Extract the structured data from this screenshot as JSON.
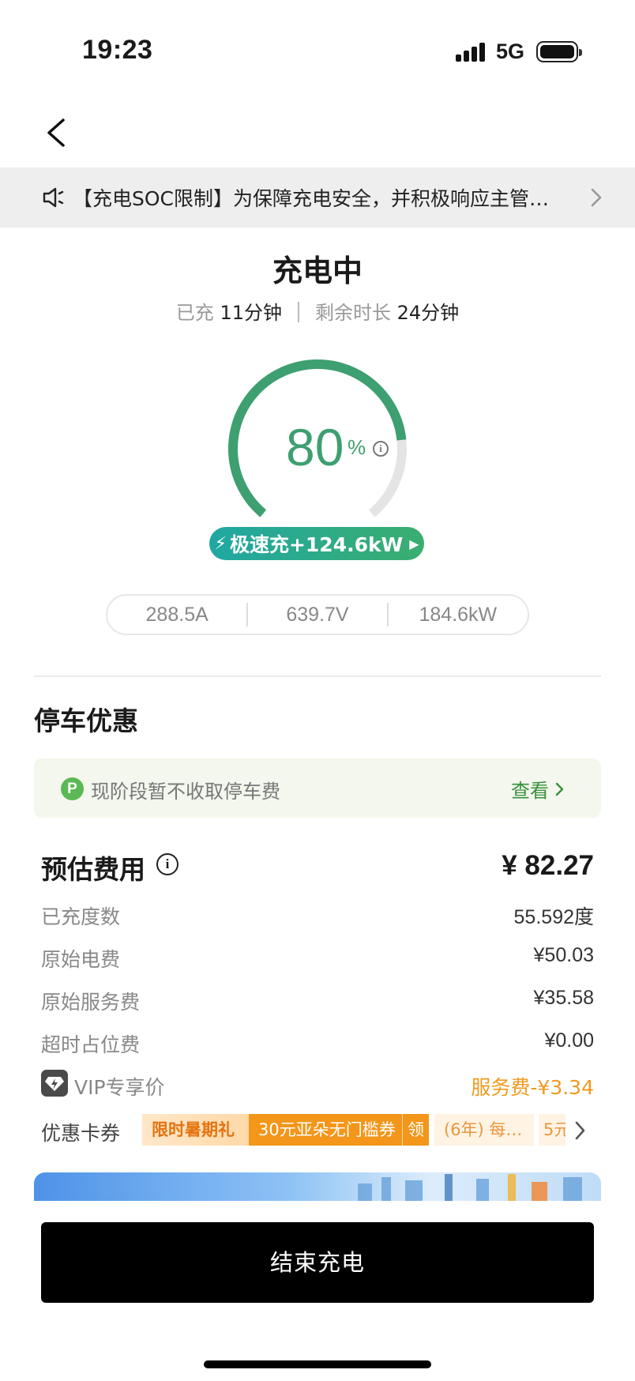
{
  "status_bar": {
    "time": "19:23",
    "network": "5G",
    "signal_bars": 4,
    "battery_level": 1.0
  },
  "notice": {
    "text": "【充电SOC限制】为保障充电安全，并积极响应主管…"
  },
  "charging": {
    "status": "充电中",
    "elapsed_label": "已充",
    "elapsed_value": "11分钟",
    "remaining_label": "剩余时长",
    "remaining_value": "24分钟",
    "percent": "80",
    "percent_unit": "%",
    "percent_fraction": 0.8,
    "fast_charge_label": "极速充+124.6kW",
    "current": "288.5A",
    "voltage": "639.7V",
    "power": "184.6kW"
  },
  "parking": {
    "title": "停车优惠",
    "message": "现阶段暂不收取停车费",
    "link": "查看",
    "icon": "P"
  },
  "fees": {
    "title": "预估费用",
    "total": "¥ 82.27",
    "rows": [
      {
        "label": "已充度数",
        "value": "55.592度"
      },
      {
        "label": "原始电费",
        "value": "¥50.03"
      },
      {
        "label": "原始服务费",
        "value": "¥35.58"
      },
      {
        "label": "超时占位费",
        "value": "¥0.00"
      }
    ],
    "vip_label": "VIP专享价",
    "vip_value": "服务费-¥3.34"
  },
  "coupons": {
    "label": "优惠卡券",
    "items": [
      "限时暑期礼",
      "30元亚朵无门槛券",
      "领",
      "(6年) 每…",
      "5元"
    ]
  },
  "actions": {
    "end_button": "结束充电"
  },
  "colors": {
    "accent_green": "#3e9f70",
    "orange": "#f09a1f",
    "track_gray": "#e4e4e4"
  }
}
